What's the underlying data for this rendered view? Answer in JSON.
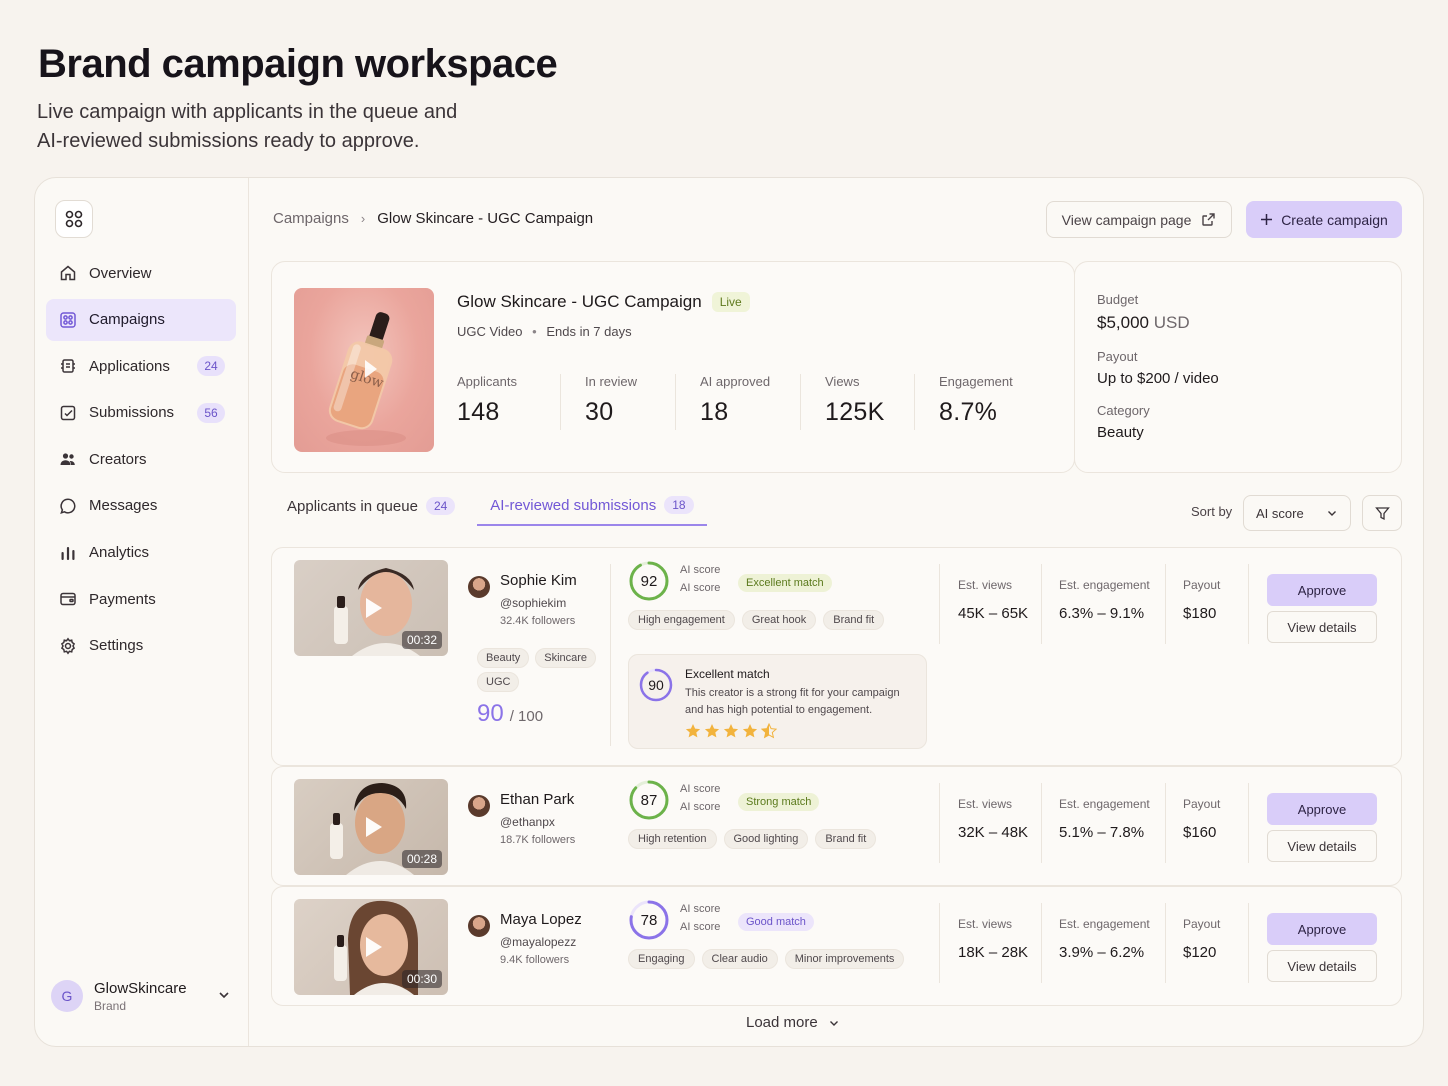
{
  "page": {
    "title": "Brand campaign workspace",
    "subtitle_line1": "Live campaign with applicants in the queue and",
    "subtitle_line2": "AI-reviewed submissions ready to approve."
  },
  "sidebar": {
    "logo_icon": "grid-icon",
    "items": [
      {
        "label": "Overview",
        "icon": "home-icon"
      },
      {
        "label": "Campaigns",
        "icon": "campaigns-icon",
        "active": true
      },
      {
        "label": "Applications",
        "icon": "applications-icon",
        "count": "24"
      },
      {
        "label": "Submissions",
        "icon": "submissions-icon",
        "count": "56"
      },
      {
        "label": "Creators",
        "icon": "users-icon"
      },
      {
        "label": "Messages",
        "icon": "chat-icon"
      },
      {
        "label": "Analytics",
        "icon": "bar-chart-icon"
      },
      {
        "label": "Payments",
        "icon": "wallet-icon"
      },
      {
        "label": "Settings",
        "icon": "gear-icon"
      }
    ],
    "account": {
      "initial": "G",
      "name": "GlowSkincare",
      "role": "Brand"
    }
  },
  "header": {
    "breadcrumb_root": "Campaigns",
    "breadcrumb_sep": "›",
    "breadcrumb_current": "Glow Skincare - UGC Campaign",
    "view_button": "View campaign page",
    "create_button": "Create campaign"
  },
  "campaign": {
    "title": "Glow Skincare - UGC Campaign",
    "status": "Live",
    "type": "UGC Video",
    "meta_sep": "•",
    "ends": "Ends in 7 days",
    "stats": [
      {
        "label": "Applicants",
        "value": "148"
      },
      {
        "label": "In review",
        "value": "30"
      },
      {
        "label": "AI approved",
        "value": "18"
      },
      {
        "label": "Views",
        "value": "125K"
      },
      {
        "label": "Engagement",
        "value": "8.7%"
      }
    ],
    "budget_label": "Budget",
    "budget_value": "$5,000",
    "budget_unit": "USD",
    "payout_label": "Payout",
    "payout_value": "Up to $200 / video",
    "category_label": "Category",
    "category_value": "Beauty"
  },
  "tabs": [
    {
      "label": "Applicants in queue",
      "count": "24"
    },
    {
      "label": "AI-reviewed submissions",
      "count": "18",
      "active": true
    }
  ],
  "sort": {
    "label": "Sort by",
    "value": "AI score"
  },
  "submissions": [
    {
      "duration": "00:32",
      "name": "Sophie Kim",
      "handle": "@sophiekim",
      "followers": "32.4K followers",
      "tags": [
        "Beauty",
        "Skincare",
        "UGC"
      ],
      "profile_score": "90",
      "profile_score_total": "/ 100",
      "ai_score": "92",
      "ai_label_1": "AI score",
      "ai_label_2": "AI score",
      "match": "Excellent match",
      "chips": [
        "High engagement",
        "Great hook",
        "Brand fit"
      ],
      "detail": {
        "score": "90",
        "title": "Excellent match",
        "text": "This creator is a strong fit for your campaign and has high potential to engagement.",
        "rating": 4.5
      },
      "views_label": "Est. views",
      "views": "45K – 65K",
      "engagement_label": "Est. engagement",
      "engagement": "6.3% – 9.1%",
      "payout_label": "Payout",
      "payout": "$180",
      "approve": "Approve",
      "details": "View details"
    },
    {
      "duration": "00:28",
      "name": "Ethan Park",
      "handle": "@ethanpx",
      "followers": "18.7K followers",
      "ai_score": "87",
      "ai_label_1": "AI score",
      "ai_label_2": "AI score",
      "match": "Strong match",
      "chips": [
        "High retention",
        "Good lighting",
        "Brand fit"
      ],
      "views_label": "Est. views",
      "views": "32K – 48K",
      "engagement_label": "Est. engagement",
      "engagement": "5.1% – 7.8%",
      "payout_label": "Payout",
      "payout": "$160",
      "approve": "Approve",
      "details": "View details"
    },
    {
      "duration": "00:30",
      "name": "Maya Lopez",
      "handle": "@mayalopezz",
      "followers": "9.4K followers",
      "ai_score": "78",
      "ai_label_1": "AI score",
      "ai_label_2": "AI score",
      "match": "Good match",
      "chips": [
        "Engaging",
        "Clear audio",
        "Minor improvements"
      ],
      "views_label": "Est. views",
      "views": "18K – 28K",
      "engagement_label": "Est. engagement",
      "engagement": "3.9% – 6.2%",
      "payout_label": "Payout",
      "payout": "$120",
      "approve": "Approve",
      "details": "View details"
    }
  ],
  "load_more": "Load more",
  "colors": {
    "accent": "#7258d6",
    "accent_soft": "#d9cdf9",
    "green_badge": "#5b7a1c",
    "ring_green": "#6cb24a",
    "ring_purple": "#8b73e8",
    "star": "#f2b33d"
  }
}
